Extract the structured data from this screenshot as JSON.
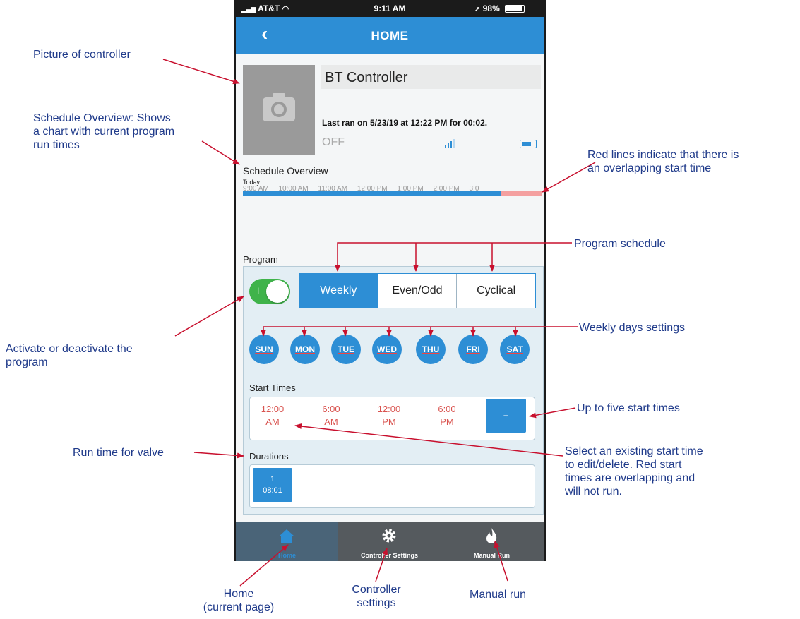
{
  "status_bar": {
    "carrier": "AT&T",
    "time": "9:11 AM",
    "battery": "98%"
  },
  "header": {
    "back_icon": "chevron-left",
    "title": "HOME"
  },
  "controller": {
    "photo_icon": "camera-icon",
    "name": "BT Controller",
    "last_ran": "Last ran on 5/23/19 at 12:22 PM for 00:02.",
    "state": "OFF"
  },
  "schedule_overview": {
    "title": "Schedule Overview",
    "day": "Today",
    "times": [
      "9:00 AM",
      "10:00 AM",
      "11:00 AM",
      "12:00 PM",
      "1:00 PM",
      "2:00 PM",
      "3:0"
    ]
  },
  "program": {
    "label": "Program",
    "toggle_text": "I",
    "schedule_types": [
      "Weekly",
      "Even/Odd",
      "Cyclical"
    ],
    "active_schedule": "Weekly",
    "days": [
      "SUN",
      "MON",
      "TUE",
      "WED",
      "THU",
      "FRI",
      "SAT"
    ],
    "start_times_label": "Start Times",
    "start_times": [
      {
        "time": "12:00",
        "period": "AM"
      },
      {
        "time": "6:00",
        "period": "AM"
      },
      {
        "time": "12:00",
        "period": "PM"
      },
      {
        "time": "6:00",
        "period": "PM"
      }
    ],
    "add_start_time_label": "+",
    "durations_label": "Durations",
    "durations": [
      {
        "valve": "1",
        "time": "08:01"
      }
    ]
  },
  "tab_bar": [
    {
      "label": "Home",
      "icon": "home-icon",
      "active": true
    },
    {
      "label": "Controller Settings",
      "icon": "gear-icon",
      "active": false
    },
    {
      "label": "Manual Run",
      "icon": "flame-icon",
      "active": false
    }
  ],
  "colors": {
    "accent": "#2d8ed5",
    "toggle_on": "#3fb34a",
    "overlap_red": "#f4a0a0",
    "callout_text": "#1f3a8a",
    "callout_arrow": "#c8102e"
  },
  "annotations": {
    "picture": "Picture of controller",
    "overview_line1": "Schedule Overview: Shows",
    "overview_line2": "a chart with current program",
    "overview_line3": "run times",
    "red_lines_line1": "Red lines indicate that there is",
    "red_lines_line2": "an overlapping start time",
    "program_schedule": "Program schedule",
    "weekly_days": "Weekly days settings",
    "activate_line1": "Activate or deactivate the",
    "activate_line2": "program",
    "five_start": "Up to five start times",
    "select_line1": "Select an existing start time",
    "select_line2": "to edit/delete. Red start",
    "select_line3": "times are overlapping and",
    "select_line4": "will not run.",
    "run_time": "Run time for valve",
    "home_line1": "Home",
    "home_line2": "(current page)",
    "settings_line1": "Controller",
    "settings_line2": "settings",
    "manual_run": "Manual run"
  }
}
